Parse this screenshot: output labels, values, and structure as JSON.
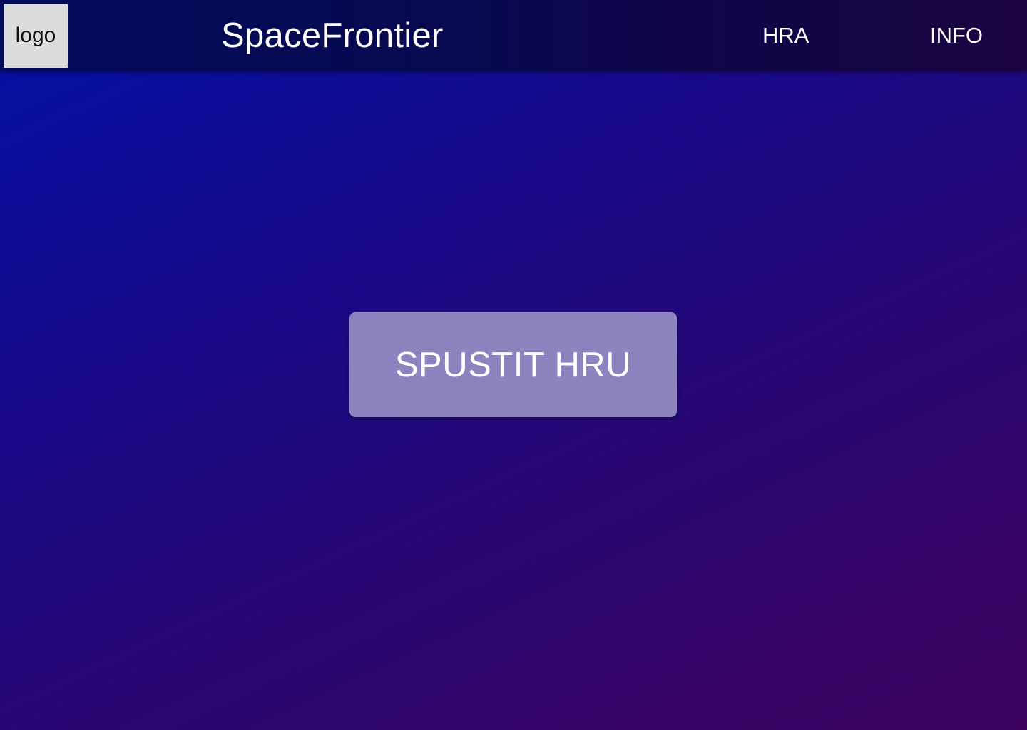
{
  "header": {
    "logo_text": "logo",
    "brand_title": "SpaceFrontier",
    "nav": {
      "hra": "HRA",
      "info": "INFO"
    }
  },
  "main": {
    "start_button_label": "SPUSTIT HRU"
  },
  "colors": {
    "header_bg": "#05094f",
    "background_start": "#0212a6",
    "background_end": "#3d0260",
    "button_bg": "#8c83bf",
    "text": "#ffffff",
    "logo_bg": "#dcdcdc"
  }
}
